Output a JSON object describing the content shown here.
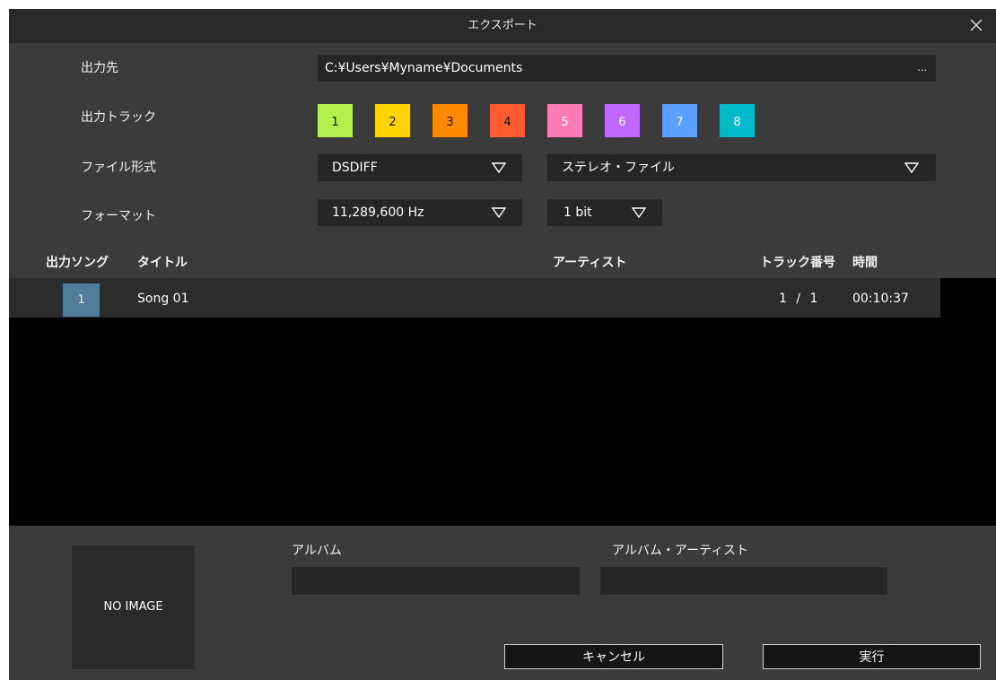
{
  "window": {
    "title": "エクスポート"
  },
  "labels": {
    "output_dest": "出力先",
    "output_track": "出力トラック",
    "file_format": "ファイル形式",
    "format": "フォーマット"
  },
  "output_path": "C:¥Users¥Myname¥Documents",
  "browse_label": "...",
  "tracks": [
    {
      "label": "1",
      "color": "#b4f04d"
    },
    {
      "label": "2",
      "color": "#ffd400"
    },
    {
      "label": "3",
      "color": "#ff8a00"
    },
    {
      "label": "4",
      "color": "#ff5b2f"
    },
    {
      "label": "5",
      "color": "#ff7bb6"
    },
    {
      "label": "6",
      "color": "#c067ff"
    },
    {
      "label": "7",
      "color": "#5aa0ff"
    },
    {
      "label": "8",
      "color": "#00b9c9"
    }
  ],
  "file_type": "DSDIFF",
  "channel_mode": "ステレオ・ファイル",
  "sample_rate": "11,289,600 Hz",
  "bit_depth": "1 bit",
  "columns": {
    "song": "出力ソング",
    "title": "タイトル",
    "artist": "アーティスト",
    "track_no": "トラック番号",
    "time": "時間"
  },
  "songs": [
    {
      "num": "1",
      "title": "Song 01",
      "artist": "",
      "track": "1 / 1",
      "time": "00:10:37"
    }
  ],
  "album": {
    "label": "アルバム",
    "value": ""
  },
  "album_artist": {
    "label": "アルバム・アーティスト",
    "value": ""
  },
  "no_image": "NO IMAGE",
  "buttons": {
    "cancel": "キャンセル",
    "run": "実行"
  }
}
